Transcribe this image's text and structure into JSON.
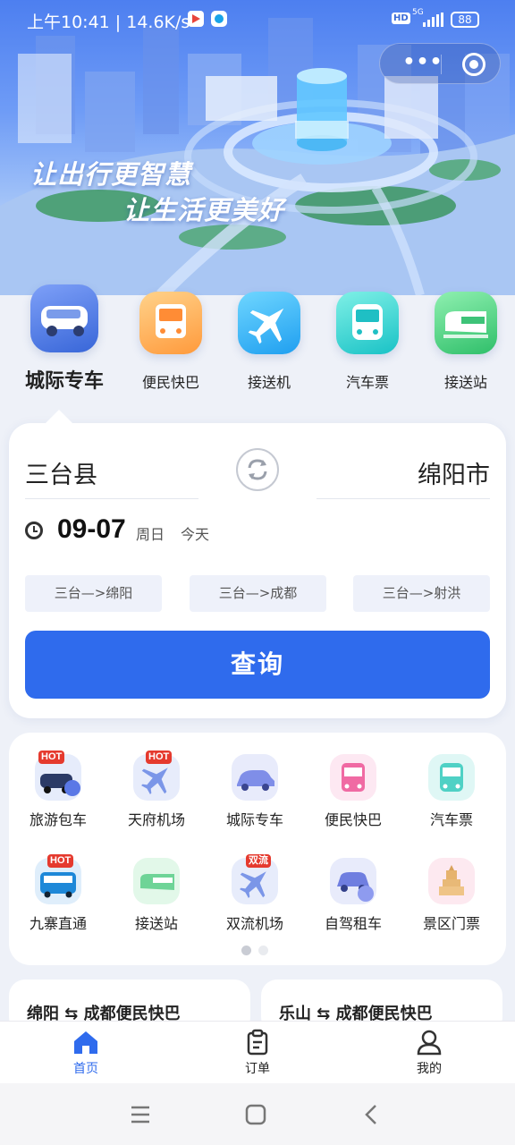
{
  "status_bar": {
    "time": "上午10:41 | 14.6K/s",
    "hd": "HD",
    "network": "5G",
    "battery": "88"
  },
  "capsule": {
    "more": "•••",
    "close_icon": "target-circle-icon"
  },
  "hero": {
    "slogan_line1": "让出行更智慧",
    "slogan_line2": "让生活更美好"
  },
  "categories": [
    {
      "label": "城际专车",
      "icon": "van-icon",
      "active": true
    },
    {
      "label": "便民快巴",
      "icon": "bus-icon"
    },
    {
      "label": "接送机",
      "icon": "airplane-icon"
    },
    {
      "label": "汽车票",
      "icon": "coach-icon"
    },
    {
      "label": "接送站",
      "icon": "train-icon"
    }
  ],
  "search": {
    "from": "三台县",
    "to": "绵阳市",
    "date": "09-07",
    "weekday": "周日",
    "today": "今天",
    "routes": [
      "三台—>绵阳",
      "三台—>成都",
      "三台—>射洪"
    ],
    "query_label": "查询"
  },
  "services": [
    {
      "label": "旅游包车",
      "icon": "tour-car-icon",
      "tag": "HOT"
    },
    {
      "label": "天府机场",
      "icon": "airplane-icon",
      "tag": "HOT"
    },
    {
      "label": "城际专车",
      "icon": "car-icon"
    },
    {
      "label": "便民快巴",
      "icon": "bus-icon"
    },
    {
      "label": "汽车票",
      "icon": "coach-icon"
    },
    {
      "label": "九寨直通",
      "icon": "bus-icon",
      "tag": "HOT"
    },
    {
      "label": "接送站",
      "icon": "train-icon"
    },
    {
      "label": "双流机场",
      "icon": "airplane-icon",
      "tag": "双流"
    },
    {
      "label": "自驾租车",
      "icon": "rental-car-icon"
    },
    {
      "label": "景区门票",
      "icon": "pagoda-icon"
    }
  ],
  "route_cards": [
    "绵阳 ⇆ 成都便民快巴",
    "乐山 ⇆ 成都便民快巴"
  ],
  "tabbar": [
    {
      "label": "首页",
      "icon": "home-icon",
      "active": true
    },
    {
      "label": "订单",
      "icon": "clipboard-icon"
    },
    {
      "label": "我的",
      "icon": "user-icon"
    }
  ],
  "colors": {
    "primary": "#2f6bed",
    "hot": "#e53a2e",
    "background": "#eef1f8"
  }
}
